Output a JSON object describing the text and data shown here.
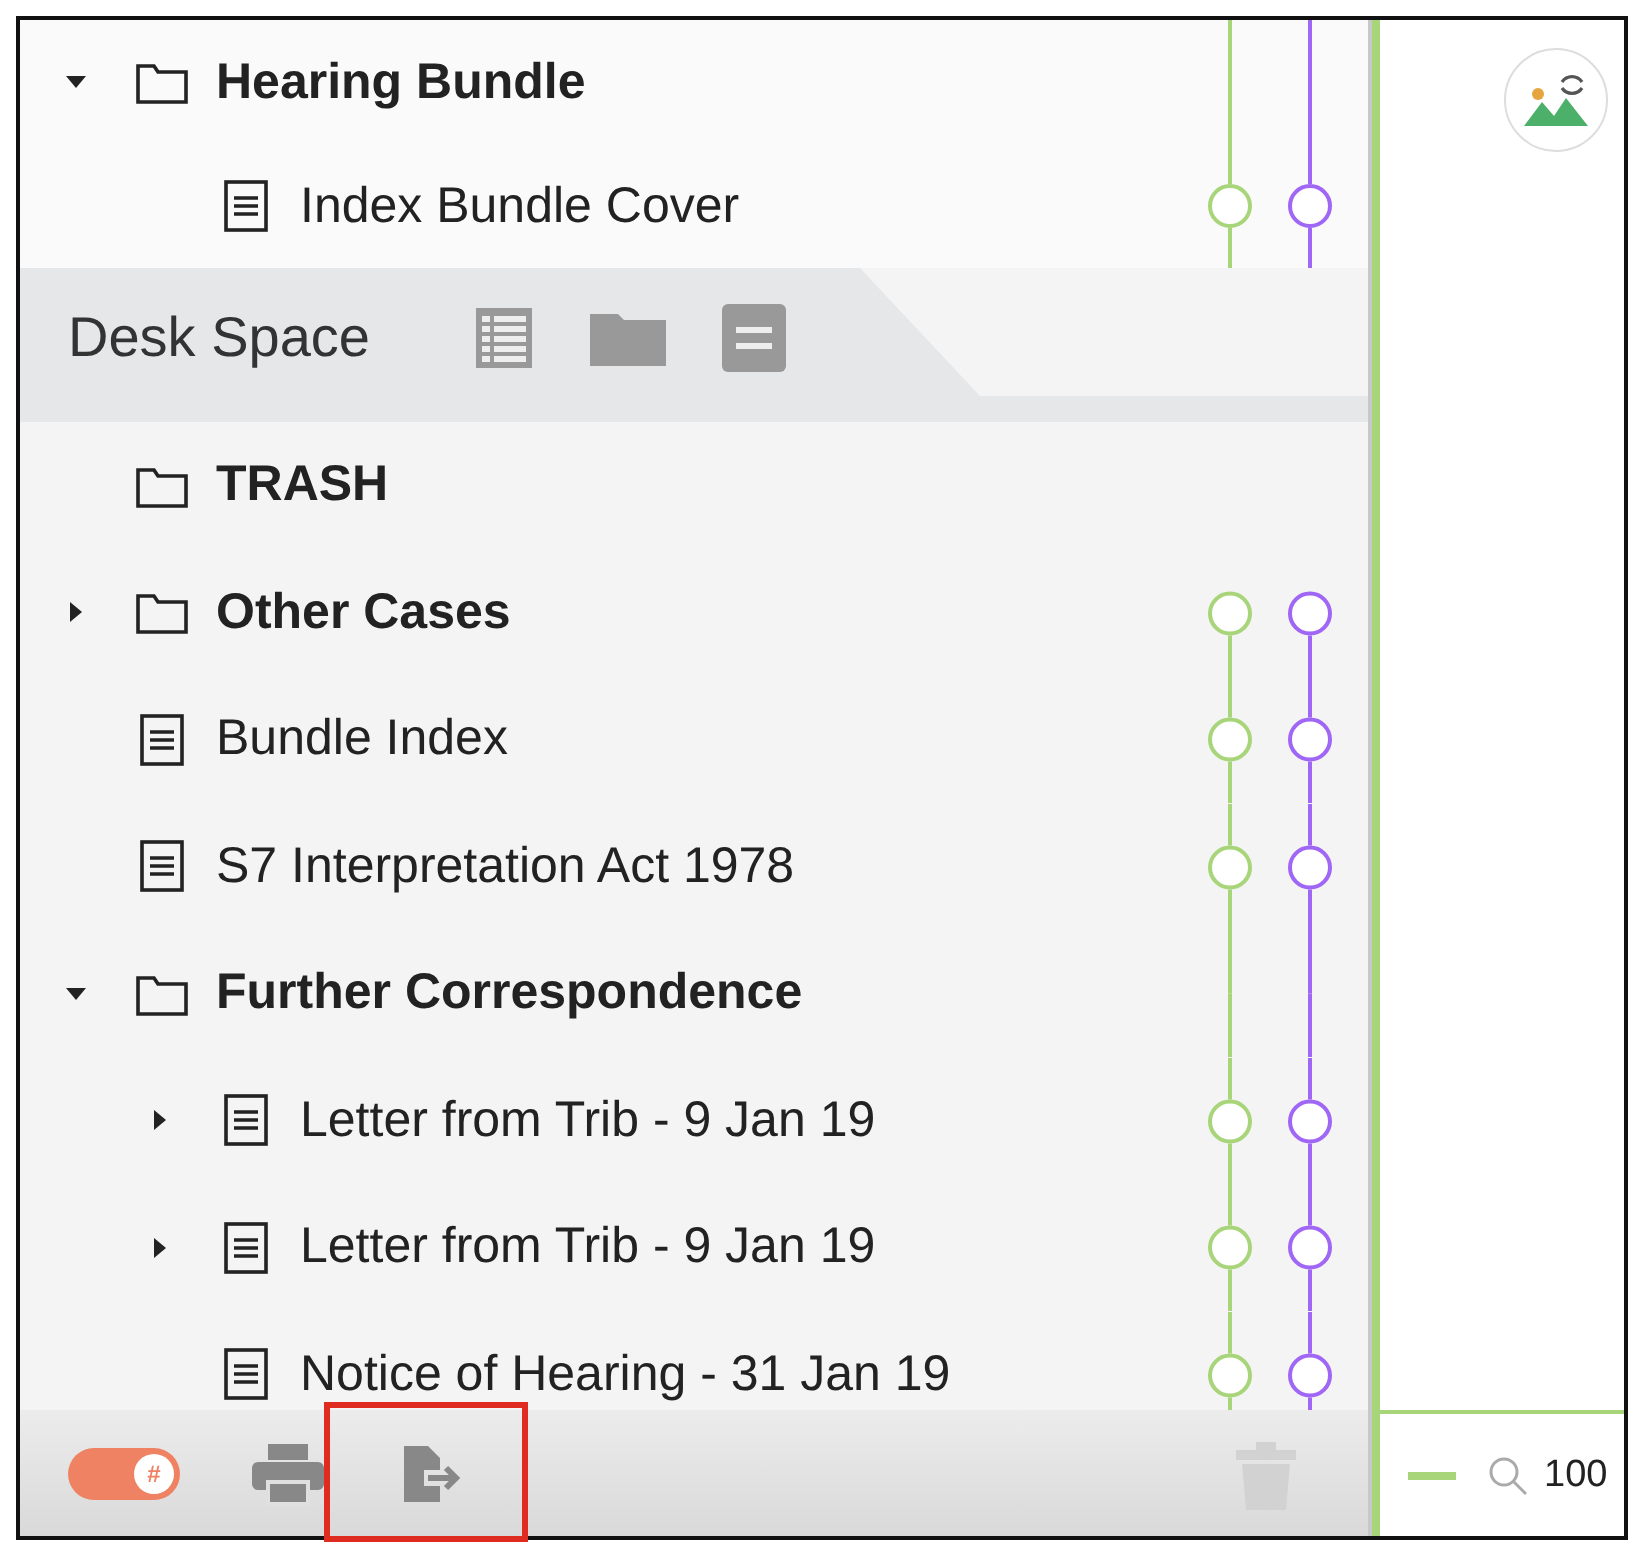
{
  "top_tree": [
    {
      "kind": "folder",
      "label": "Hearing Bundle",
      "expanded": true,
      "marked": false,
      "children": [
        {
          "kind": "document",
          "label": "Index Bundle Cover",
          "marked": true
        }
      ]
    }
  ],
  "desk_space": {
    "label": "Desk Space"
  },
  "tree": [
    {
      "kind": "folder",
      "label": "TRASH",
      "marked": false
    },
    {
      "kind": "folder",
      "label": "Other Cases",
      "expanded": false,
      "marked": true
    },
    {
      "kind": "document",
      "label": "Bundle Index",
      "marked": true
    },
    {
      "kind": "document",
      "label": "S7 Interpretation Act 1978",
      "marked": true
    },
    {
      "kind": "folder",
      "label": "Further Correspondence",
      "expanded": true,
      "marked": false,
      "children": [
        {
          "kind": "document",
          "label": "Letter from Trib - 9 Jan 19",
          "expanded": false,
          "marked": true
        },
        {
          "kind": "document",
          "label": "Letter from Trib - 9 Jan 19",
          "expanded": false,
          "marked": true
        },
        {
          "kind": "document",
          "label": "Notice of Hearing - 31 Jan 19",
          "marked": true
        }
      ]
    }
  ],
  "toolbar": {
    "toggle": {
      "on": true,
      "glyph": "#"
    },
    "export_highlighted": true
  },
  "viewer": {
    "zoom": "100"
  }
}
